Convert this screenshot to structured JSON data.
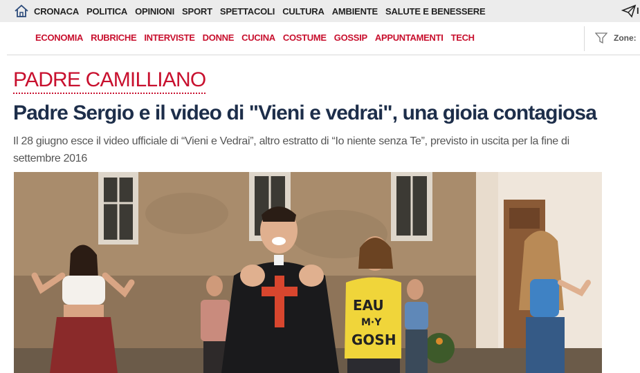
{
  "top_nav": {
    "items": [
      "CRONACA",
      "POLITICA",
      "OPINIONI",
      "SPORT",
      "SPETTACOLI",
      "CULTURA",
      "AMBIENTE",
      "SALUTE E BENESSERE"
    ],
    "partial_label": "I"
  },
  "sub_nav": {
    "items": [
      "ECONOMIA",
      "RUBRICHE",
      "INTERVISTE",
      "DONNE",
      "CUCINA",
      "COSTUME",
      "GOSSIP",
      "APPUNTAMENTI",
      "TECH"
    ],
    "zone_label": "Zone:"
  },
  "icons": {
    "home": "home-icon",
    "send": "paper-plane-icon",
    "filter": "filter-icon"
  },
  "article": {
    "category": "PADRE CAMILLIANO",
    "headline": "Padre Sergio e il video di \"Vieni e vedrai\", una gioia contagiosa",
    "summary": "Il 28 giugno esce il video ufficiale di “Vieni e Vedrai”, altro estratto di “Io niente senza Te”, previsto in uscita per la fine di settembre 2016",
    "image_text": {
      "shirt_line1": "EAU",
      "shirt_line2": "M·Y",
      "shirt_line3": "GOSH"
    }
  },
  "colors": {
    "accent_red": "#c8102e",
    "headline_navy": "#1d2e4a",
    "topbar_bg": "#ececec"
  }
}
